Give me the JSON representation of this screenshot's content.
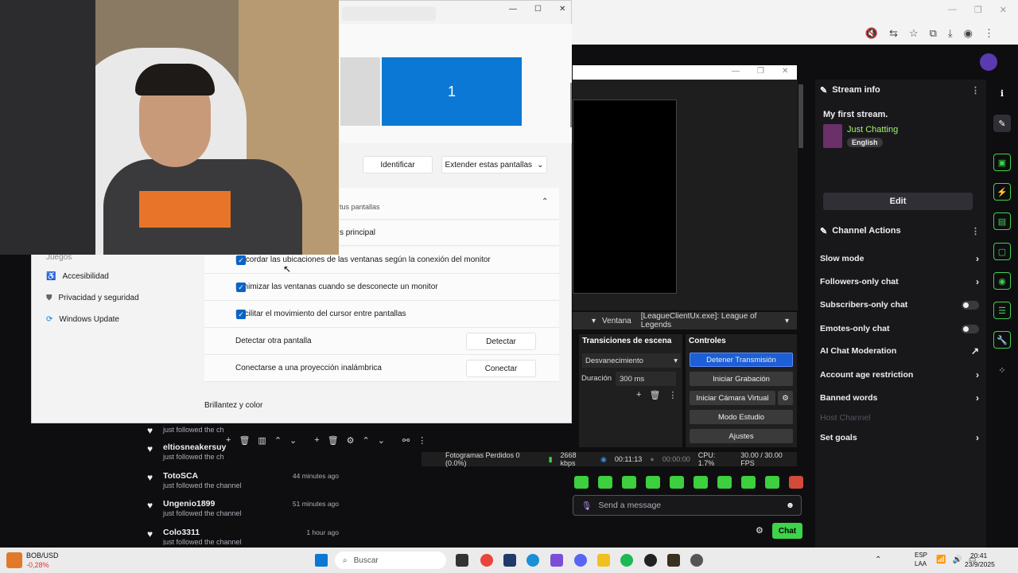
{
  "stream_info": {
    "panel_title": "Stream info",
    "stream_title": "My first stream.",
    "category": "Just Chatting",
    "language": "English",
    "edit_label": "Edit"
  },
  "channel_actions": {
    "panel_title": "Channel Actions",
    "items": [
      {
        "label": "Slow mode",
        "control": "chevron"
      },
      {
        "label": "Followers-only chat",
        "control": "chevron"
      },
      {
        "label": "Subscribers-only chat",
        "control": "toggle"
      },
      {
        "label": "Emotes-only chat",
        "control": "toggle"
      },
      {
        "label": "AI Chat Moderation",
        "control": "external"
      },
      {
        "label": "Account age restriction",
        "control": "chevron"
      },
      {
        "label": "Banned words",
        "control": "chevron"
      },
      {
        "label": "Host Channel",
        "control": "none"
      },
      {
        "label": "Set goals",
        "control": "chevron"
      }
    ]
  },
  "obs": {
    "source_type": "Ventana",
    "source_value": "[LeagueClientUx.exe]: League of Legends",
    "transitions": {
      "title": "Transiciones de escena",
      "type": "Desvanecimiento",
      "duration_label": "Duración",
      "duration_value": "300 ms"
    },
    "controls": {
      "title": "Controles",
      "buttons": [
        "Detener Transmisión",
        "Iniciar Grabación",
        "Iniciar Cámara Virtual",
        "Modo Estudio",
        "Ajustes"
      ]
    },
    "status": {
      "dropped": "Fotogramas Perdidos 0 (0.0%)",
      "bitrate": "2668 kbps",
      "live_time": "00:11:13",
      "rec_time": "00:00:00",
      "cpu": "CPU: 1.7%",
      "fps": "30.00 / 30.00 FPS"
    }
  },
  "chat": {
    "placeholder": "Send a message",
    "send_label": "Chat"
  },
  "follower_feed": [
    {
      "name": "",
      "sub": "just followed the ch",
      "time": ""
    },
    {
      "name": "eltiosneakersuy",
      "sub": "just followed the ch",
      "time": ""
    },
    {
      "name": "TotoSCA",
      "sub": "just followed the channel",
      "time": "44 minutes ago"
    },
    {
      "name": "Ungenio1899",
      "sub": "just followed the channel",
      "time": "51 minutes ago"
    },
    {
      "name": "Colo3311",
      "sub": "just followed the channel",
      "time": "1 hour ago"
    }
  ],
  "settings": {
    "monitor_number": "1",
    "identify_label": "Identificar",
    "extend_label": "Extender estas pantallas",
    "section_label": "tus pantallas",
    "main_row": "s principal",
    "rows": [
      {
        "label": "Recordar las ubicaciones de las ventanas según la conexión del monitor",
        "checked": true
      },
      {
        "label": "Minimizar las ventanas cuando se desconecte un monitor",
        "checked": true
      },
      {
        "label": "Facilitar el movimiento del cursor entre pantallas",
        "checked": true
      }
    ],
    "detect_label": "Detectar otra pantalla",
    "detect_button": "Detectar",
    "wireless_label": "Conectarse a una proyección inalámbrica",
    "wireless_button": "Conectar",
    "brightness_heading": "Brillantez y color",
    "nav": [
      "Juegos",
      "Accesibilidad",
      "Privacidad y seguridad",
      "Windows Update"
    ]
  },
  "taskbar": {
    "ticker_name": "BOB/USD",
    "ticker_value": "-0,28%",
    "search_placeholder": "Buscar",
    "lang_top": "ESP",
    "lang_bottom": "LAA",
    "time": "20:41",
    "date": "23/9/2025"
  },
  "colors": {
    "twitch_green": "#3dd34a",
    "obs_stop_blue": "#1c5fd6",
    "windows_accent": "#0a78d4"
  }
}
